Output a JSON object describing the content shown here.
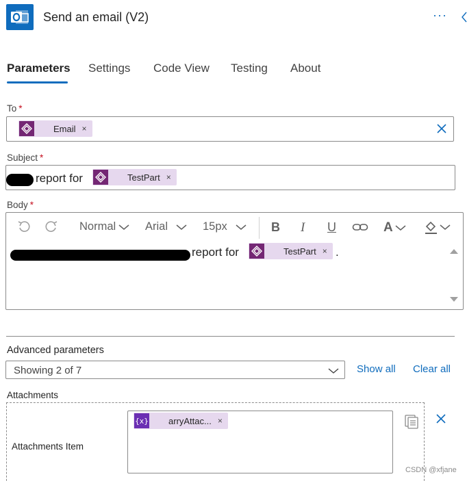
{
  "header": {
    "title": "Send an email (V2)",
    "more_glyph": "···",
    "icon": "outlook-icon"
  },
  "tabs": [
    {
      "label": "Parameters",
      "active": true
    },
    {
      "label": "Settings",
      "active": false
    },
    {
      "label": "Code View",
      "active": false
    },
    {
      "label": "Testing",
      "active": false
    },
    {
      "label": "About",
      "active": false
    }
  ],
  "fields": {
    "to": {
      "label": "To",
      "required_mark": "*",
      "token": {
        "label": "Email",
        "remove": "×"
      },
      "clear_icon": "close-icon"
    },
    "subject": {
      "label": "Subject",
      "required_mark": "*",
      "text": "report for",
      "token": {
        "label": "TestPart",
        "remove": "×"
      }
    },
    "body": {
      "label": "Body",
      "required_mark": "*",
      "text_before": "report for",
      "text_after": ".",
      "token": {
        "label": "TestPart",
        "remove": "×"
      },
      "toolbar": {
        "undo_icon": "undo-icon",
        "redo_icon": "redo-icon",
        "format": "Normal",
        "font": "Arial",
        "size": "15px",
        "bold": "B",
        "italic": "I",
        "underline": "U",
        "link_icon": "link-icon",
        "font_color": "A",
        "highlight_icon": "paint-bucket-icon"
      }
    }
  },
  "advanced": {
    "label": "Advanced parameters",
    "select_value": "Showing 2 of 7",
    "show_all": "Show all",
    "clear_all": "Clear all"
  },
  "attachments": {
    "label": "Attachments",
    "item_label": "Attachments Item",
    "token": {
      "label": "arryAttac...",
      "remove": "×",
      "icon_text": "{x}"
    }
  },
  "watermark": "CSDN @xfjane",
  "colors": {
    "accent": "#0f6cbd",
    "token_bg": "#e6d8ee",
    "token_icon": "#742774",
    "var_icon": "#6b2fb3",
    "required": "#c50f1f"
  }
}
